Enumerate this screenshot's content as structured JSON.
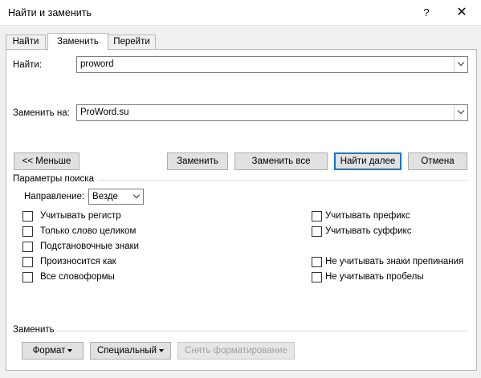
{
  "window": {
    "title": "Найти и заменить",
    "help": "?",
    "close": "✕"
  },
  "tabs": [
    {
      "label": "Найти"
    },
    {
      "label": "Заменить"
    },
    {
      "label": "Перейти"
    }
  ],
  "find": {
    "label": "Найти:",
    "value": "proword"
  },
  "replace": {
    "label": "Заменить на:",
    "value": "ProWord.su"
  },
  "buttons": {
    "less": "<< Меньше",
    "replace": "Заменить",
    "replace_all": "Заменить все",
    "find_next": "Найти далее",
    "cancel": "Отмена"
  },
  "search_options": {
    "title": "Параметры поиска",
    "direction_label": "Направление:",
    "direction_value": "Везде",
    "left": [
      {
        "label": "Учитывать регистр",
        "checked": false
      },
      {
        "label": "Только слово целиком",
        "checked": false
      },
      {
        "label": "Подстановочные знаки",
        "checked": false
      },
      {
        "label": "Произносится как",
        "checked": false
      },
      {
        "label": "Все словоформы",
        "checked": false
      }
    ],
    "right": [
      {
        "label": "Учитывать префикс",
        "checked": false
      },
      {
        "label": "Учитывать суффикс",
        "checked": false
      },
      {
        "label": "Не учитывать знаки препинания",
        "checked": false
      },
      {
        "label": "Не учитывать пробелы",
        "checked": false
      }
    ]
  },
  "replace_section": {
    "title": "Заменить",
    "format": "Формат",
    "special": "Специальный",
    "no_format": "Снять форматирование"
  }
}
